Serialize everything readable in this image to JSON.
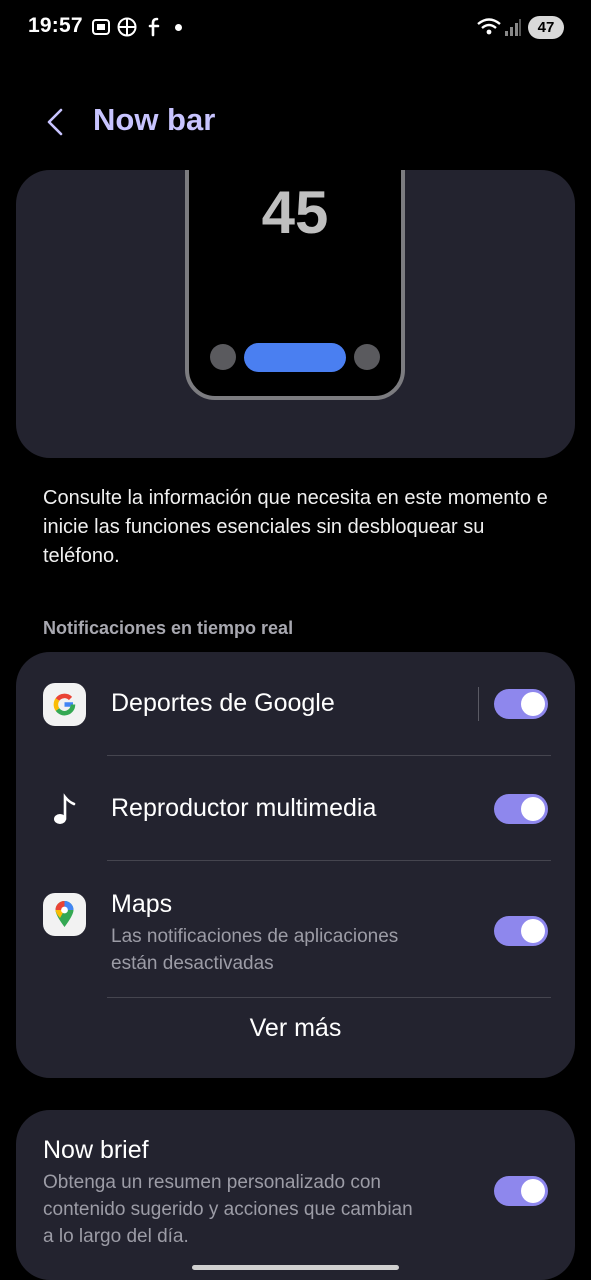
{
  "status_bar": {
    "time": "19:57",
    "battery": "47",
    "icons": [
      "screenshot-icon",
      "basketball-icon",
      "facebook-icon",
      "notification-dot",
      "wifi-icon",
      "signal-icon"
    ]
  },
  "header": {
    "title": "Now bar",
    "back_icon": "chevron-left-icon"
  },
  "preview": {
    "clock": "45"
  },
  "description": "Consulte la información que necesita en este momento e inicie las funciones esenciales sin desbloquear su teléfono.",
  "section_label": "Notificaciones en tiempo real",
  "list": {
    "items": [
      {
        "title": "Deportes de Google",
        "icon": "google-icon",
        "enabled": true
      },
      {
        "title": "Reproductor multimedia",
        "icon": "music-note-icon",
        "enabled": true
      },
      {
        "title": "Maps",
        "subtitle": "Las notificaciones de aplicaciones están desactivadas",
        "icon": "google-maps-icon",
        "enabled": true
      }
    ],
    "see_more": "Ver más"
  },
  "now_brief": {
    "title": "Now brief",
    "description": "Obtenga un resumen personalizado con contenido sugerido y acciones que cambian a lo largo del día.",
    "enabled": true
  },
  "colors": {
    "accent_title": "#c8c4ff",
    "toggle_on": "#8e87ed",
    "card_bg": "#23232f",
    "nowbar_pill": "#4a7ff1"
  }
}
